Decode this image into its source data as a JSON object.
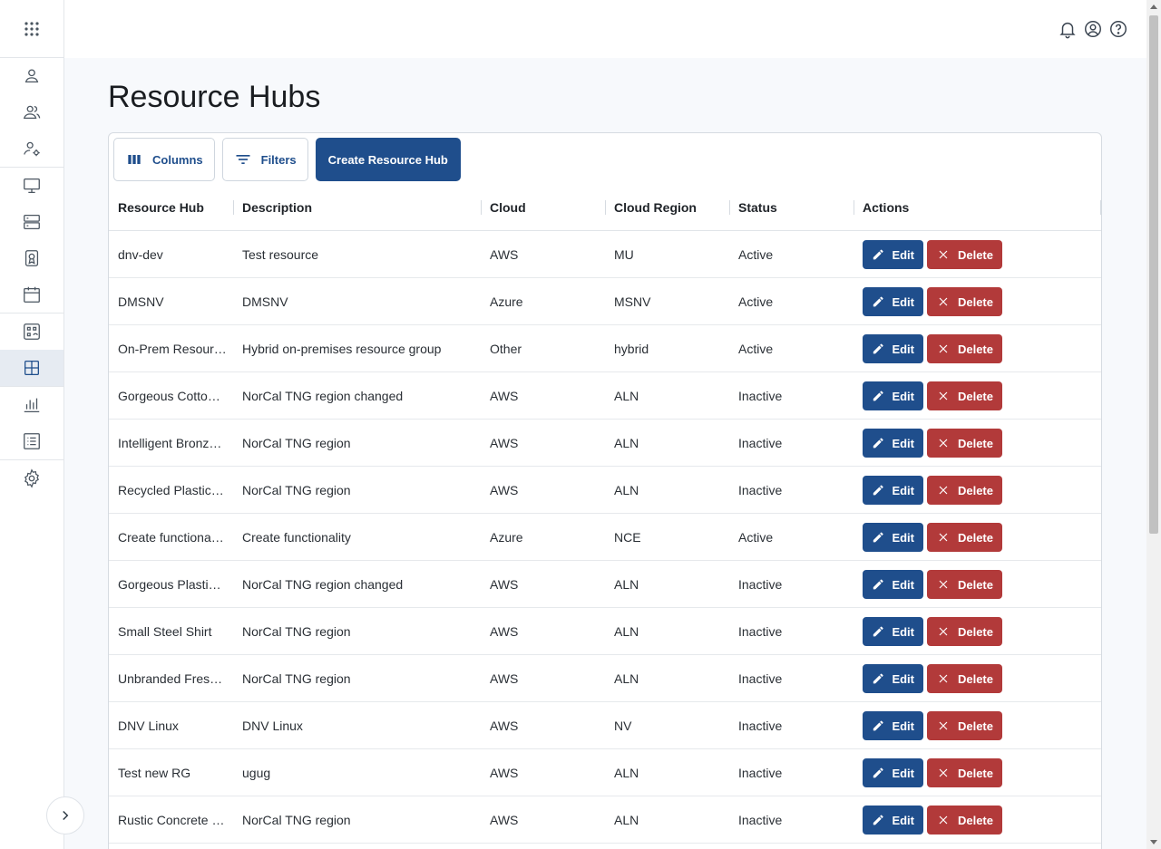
{
  "page_title": "Resource Hubs",
  "toolbar": {
    "columns_label": "Columns",
    "filters_label": "Filters",
    "create_label": "Create Resource Hub"
  },
  "columns": [
    "Resource Hub",
    "Description",
    "Cloud",
    "Cloud Region",
    "Status",
    "Actions"
  ],
  "actions": {
    "edit": "Edit",
    "delete": "Delete"
  },
  "rows": [
    {
      "hub": "dnv-dev",
      "description": "Test resource",
      "cloud": "AWS",
      "region": "MU",
      "status": "Active"
    },
    {
      "hub": "DMSNV",
      "description": "DMSNV",
      "cloud": "Azure",
      "region": "MSNV",
      "status": "Active"
    },
    {
      "hub": "On-Prem Resour…",
      "description": "Hybrid on-premises resource group",
      "cloud": "Other",
      "region": "hybrid",
      "status": "Active"
    },
    {
      "hub": "Gorgeous Cotto…",
      "description": "NorCal TNG region changed",
      "cloud": "AWS",
      "region": "ALN",
      "status": "Inactive"
    },
    {
      "hub": "Intelligent Bronz…",
      "description": "NorCal TNG region",
      "cloud": "AWS",
      "region": "ALN",
      "status": "Inactive"
    },
    {
      "hub": "Recycled Plastic…",
      "description": "NorCal TNG region",
      "cloud": "AWS",
      "region": "ALN",
      "status": "Inactive"
    },
    {
      "hub": "Create functiona…",
      "description": "Create functionality",
      "cloud": "Azure",
      "region": "NCE",
      "status": "Active"
    },
    {
      "hub": "Gorgeous Plasti…",
      "description": "NorCal TNG region changed",
      "cloud": "AWS",
      "region": "ALN",
      "status": "Inactive"
    },
    {
      "hub": "Small Steel Shirt",
      "description": "NorCal TNG region",
      "cloud": "AWS",
      "region": "ALN",
      "status": "Inactive"
    },
    {
      "hub": "Unbranded Fres…",
      "description": "NorCal TNG region",
      "cloud": "AWS",
      "region": "ALN",
      "status": "Inactive"
    },
    {
      "hub": "DNV Linux",
      "description": "DNV Linux",
      "cloud": "AWS",
      "region": "NV",
      "status": "Inactive"
    },
    {
      "hub": "Test new RG",
      "description": "ugug",
      "cloud": "AWS",
      "region": "ALN",
      "status": "Inactive"
    },
    {
      "hub": "Rustic Concrete …",
      "description": "NorCal TNG region",
      "cloud": "AWS",
      "region": "ALN",
      "status": "Inactive"
    }
  ],
  "icons": {
    "sidebar": [
      "apps-grid-icon",
      "user-icon",
      "users-icon",
      "user-settings-icon",
      "monitor-icon",
      "server-icon",
      "badge-icon",
      "calendar-icon",
      "resource-link-icon",
      "dashboard-grid-icon",
      "bar-chart-icon",
      "list-icon",
      "settings-icon"
    ],
    "topbar": [
      "bell-icon",
      "account-icon",
      "help-icon"
    ]
  },
  "colors": {
    "primary": "#1f4e8c",
    "danger": "#b23a3a"
  }
}
